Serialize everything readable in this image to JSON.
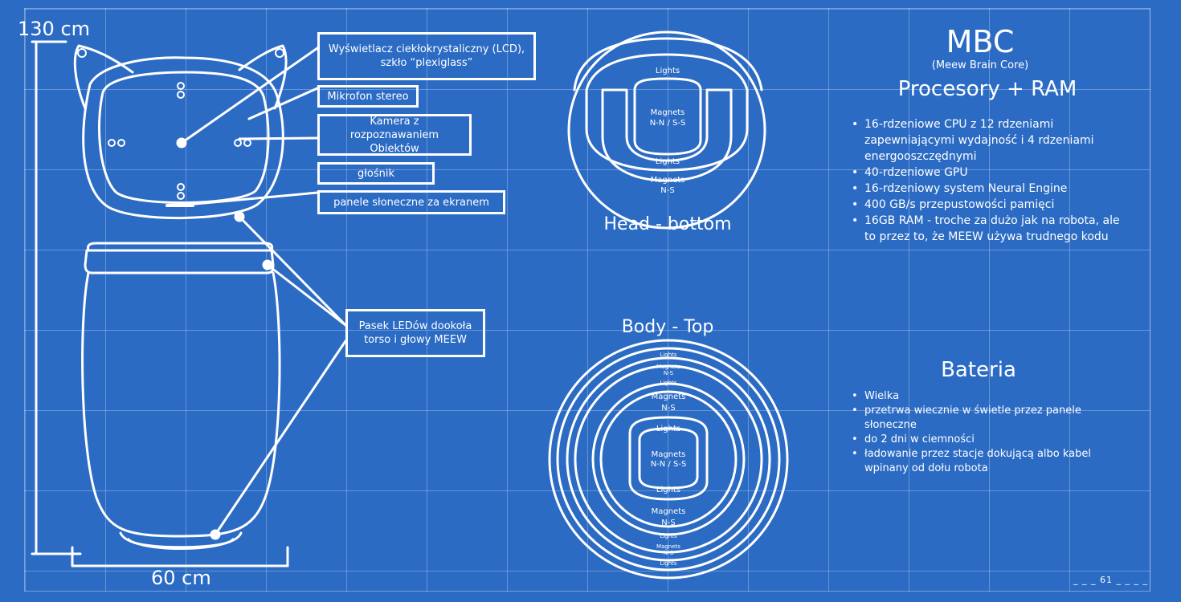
{
  "dims": {
    "height": "130 cm",
    "width": "60 cm"
  },
  "callouts": {
    "lcd": "Wyświetlacz ciekłokrystaliczny (LCD), szkło “plexiglass”",
    "mic": "Mikrofon stereo",
    "camera": "Kamera z rozpoznawaniem Obiektów",
    "speaker": "głośnik",
    "solar": "panele słoneczne za ekranem",
    "led": "Pasek LEDów dookoła torso i głowy MEEW"
  },
  "head_bottom": {
    "title": "Head - bottom",
    "lights": "Lights",
    "magnets": "Magnets",
    "nn_ss": "N-N / S-S",
    "ns": "N-S"
  },
  "body_top": {
    "title": "Body - Top",
    "lights": "Lights",
    "magnets": "Magnets",
    "nn_ss": "N-N / S-S",
    "ns": "N-S"
  },
  "mbc": {
    "title": "MBC",
    "subtitle": "(Meew Brain Core)",
    "heading": "Procesory + RAM",
    "items": [
      "16-rdzeniowe CPU z 12 rdzeniami zapewniającymi wydajność i 4 rdzeniami energooszczędnymi",
      "40-rdzeniowe GPU",
      "16-rdzeniowy system Neural Engine",
      "400 GB/s przepustowości pamięci",
      "16GB RAM - troche za dużo jak na robota, ale to przez to, że MEEW używa trudnego kodu"
    ]
  },
  "battery": {
    "heading": "Bateria",
    "items": [
      "Wielka",
      "przetrwa wiecznie w świetle przez panele słoneczne",
      "do 2 dni w ciemności",
      "ładowanie przez stacje dokującą albo kabel wpinany od dołu robota"
    ]
  },
  "page": {
    "number": "_ _ _ 61 _ _ _ _"
  }
}
